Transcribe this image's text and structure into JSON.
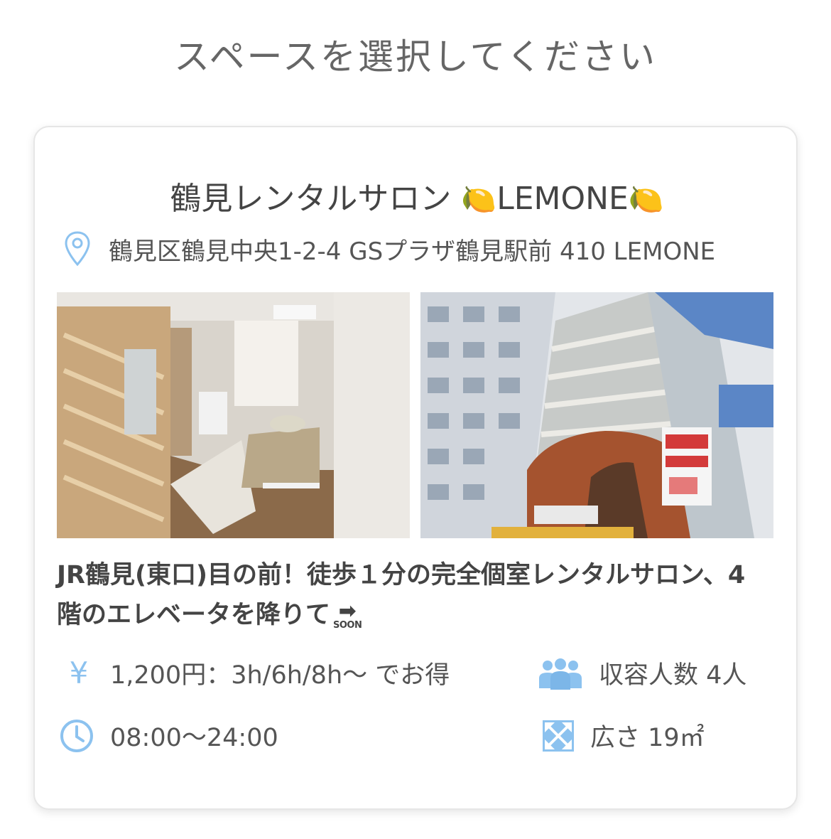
{
  "page": {
    "title": "スペースを選択してください"
  },
  "space": {
    "name": "鶴見レンタルサロン ",
    "name_emoji_left": "🍋",
    "name_brand": "LEMONE",
    "name_emoji_right": "🍋",
    "address": "鶴見区鶴見中央1-2-4 GSプラザ鶴見駅前 410 LEMONE",
    "description": "JR鶴見(東口)目の前！徒歩１分の完全個室レンタルサロン、4階のエレベータを降りて",
    "description_arrow": "➡",
    "description_soon": "SOON",
    "price_symbol": "¥",
    "price": "1,200円：3h/6h/8h〜 でお得",
    "capacity": "収容人数 4人",
    "hours": "08:00〜24:00",
    "area": "広さ 19㎡"
  },
  "icons": {
    "location": "location-pin-icon",
    "price": "yen-icon",
    "capacity": "people-icon",
    "hours": "clock-icon",
    "area": "expand-icon"
  },
  "colors": {
    "icon_blue": "#8cc2ef",
    "text": "#555555",
    "border": "#e6e6e6"
  }
}
